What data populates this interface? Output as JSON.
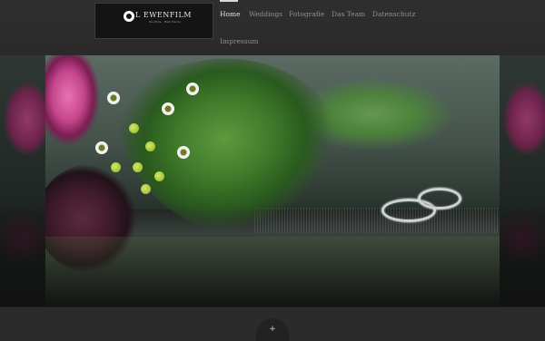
{
  "brand": {
    "logo_text": "L EWENFILM",
    "logo_subtext": "Die Filme · Mark Harms"
  },
  "nav": {
    "items": [
      {
        "label": "Home",
        "active": true
      },
      {
        "label": "Weddings",
        "active": false
      },
      {
        "label": "Fotografie",
        "active": false
      },
      {
        "label": "Das Team",
        "active": false
      },
      {
        "label": "Datenschutz",
        "active": false
      },
      {
        "label": "Impressum",
        "active": false
      }
    ]
  },
  "hero": {
    "image_subject": "wedding rings on wet glass with calla lily bouquet"
  },
  "footer": {
    "toggle_label": "+"
  },
  "colors": {
    "background": "#2e2e2e",
    "nav_active": "#e4e4e4",
    "nav_inactive": "#8f8f8f",
    "footer": "#2b2b2b"
  }
}
